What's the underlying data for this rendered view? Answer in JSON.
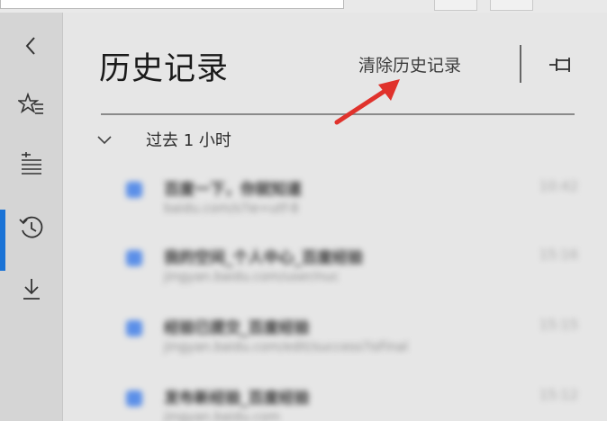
{
  "sidebar": {
    "back_icon": "chevron-left-icon",
    "favorites_icon": "star-list-icon",
    "reading_list_icon": "reading-list-icon",
    "history_icon": "history-icon",
    "downloads_icon": "download-icon",
    "accent_color": "#1a73d6"
  },
  "history": {
    "title": "历史记录",
    "clear_label": "清除历史记录",
    "pin_icon": "pin-icon",
    "group_label": "过去 1 小时",
    "items": [
      {
        "title": "百度一下，你就知道",
        "url": "baidu.com/s?ie=utf-8",
        "time": "10:42"
      },
      {
        "title": "我的空间_个人中心_百度经验",
        "url": "jingyan.baidu.com/user/nuc",
        "time": "15:16"
      },
      {
        "title": "经验已提交_百度经验",
        "url": "jingyan.baidu.com/edit/success?isFinal",
        "time": "15:15"
      },
      {
        "title": "发布新经验_百度经验",
        "url": "jingyan.baidu.com",
        "time": "15:12"
      }
    ]
  },
  "annotation": {
    "arrow_color": "#e0322c"
  }
}
